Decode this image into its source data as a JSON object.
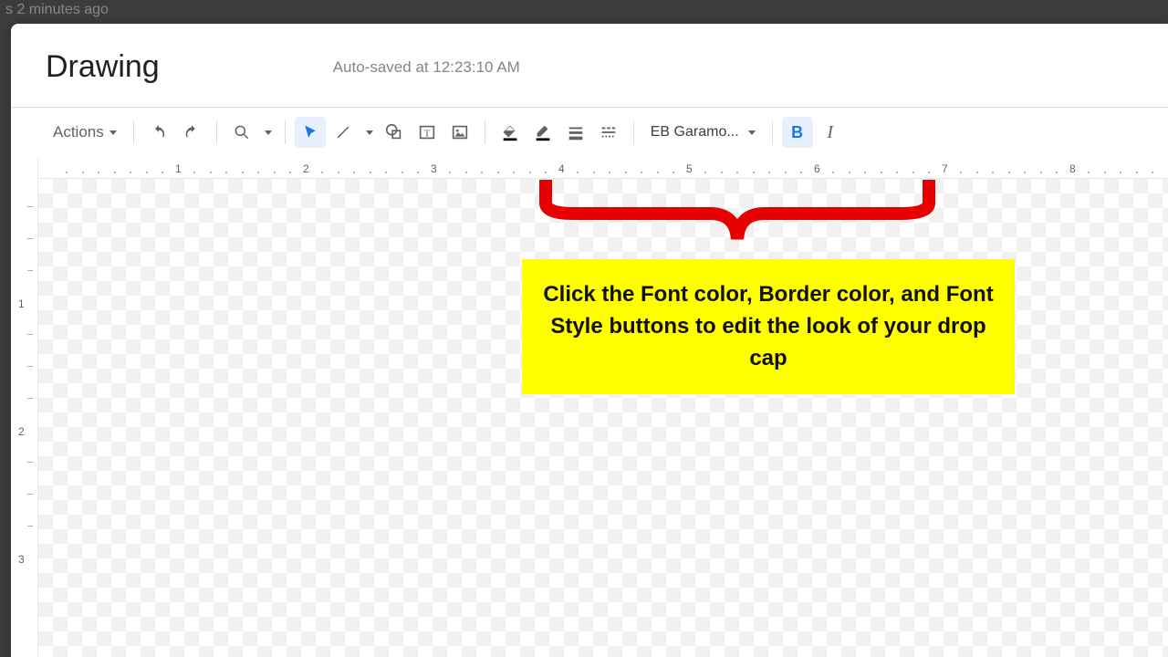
{
  "shadow_text": "s 2 minutes ago",
  "header": {
    "title": "Drawing",
    "autosave": "Auto-saved at 12:23:10 AM"
  },
  "toolbar": {
    "actions": "Actions",
    "font": "EB Garamo..."
  },
  "ruler": {
    "one": "1",
    "two": "2",
    "three": "3",
    "four": "4",
    "five": "5",
    "six": "6",
    "seven": "7",
    "eight": "8"
  },
  "vruler": {
    "one": "1",
    "two": "2",
    "three": "3"
  },
  "callout": "Click the Font color, Border color, and Font Style buttons to edit the look of your drop cap"
}
